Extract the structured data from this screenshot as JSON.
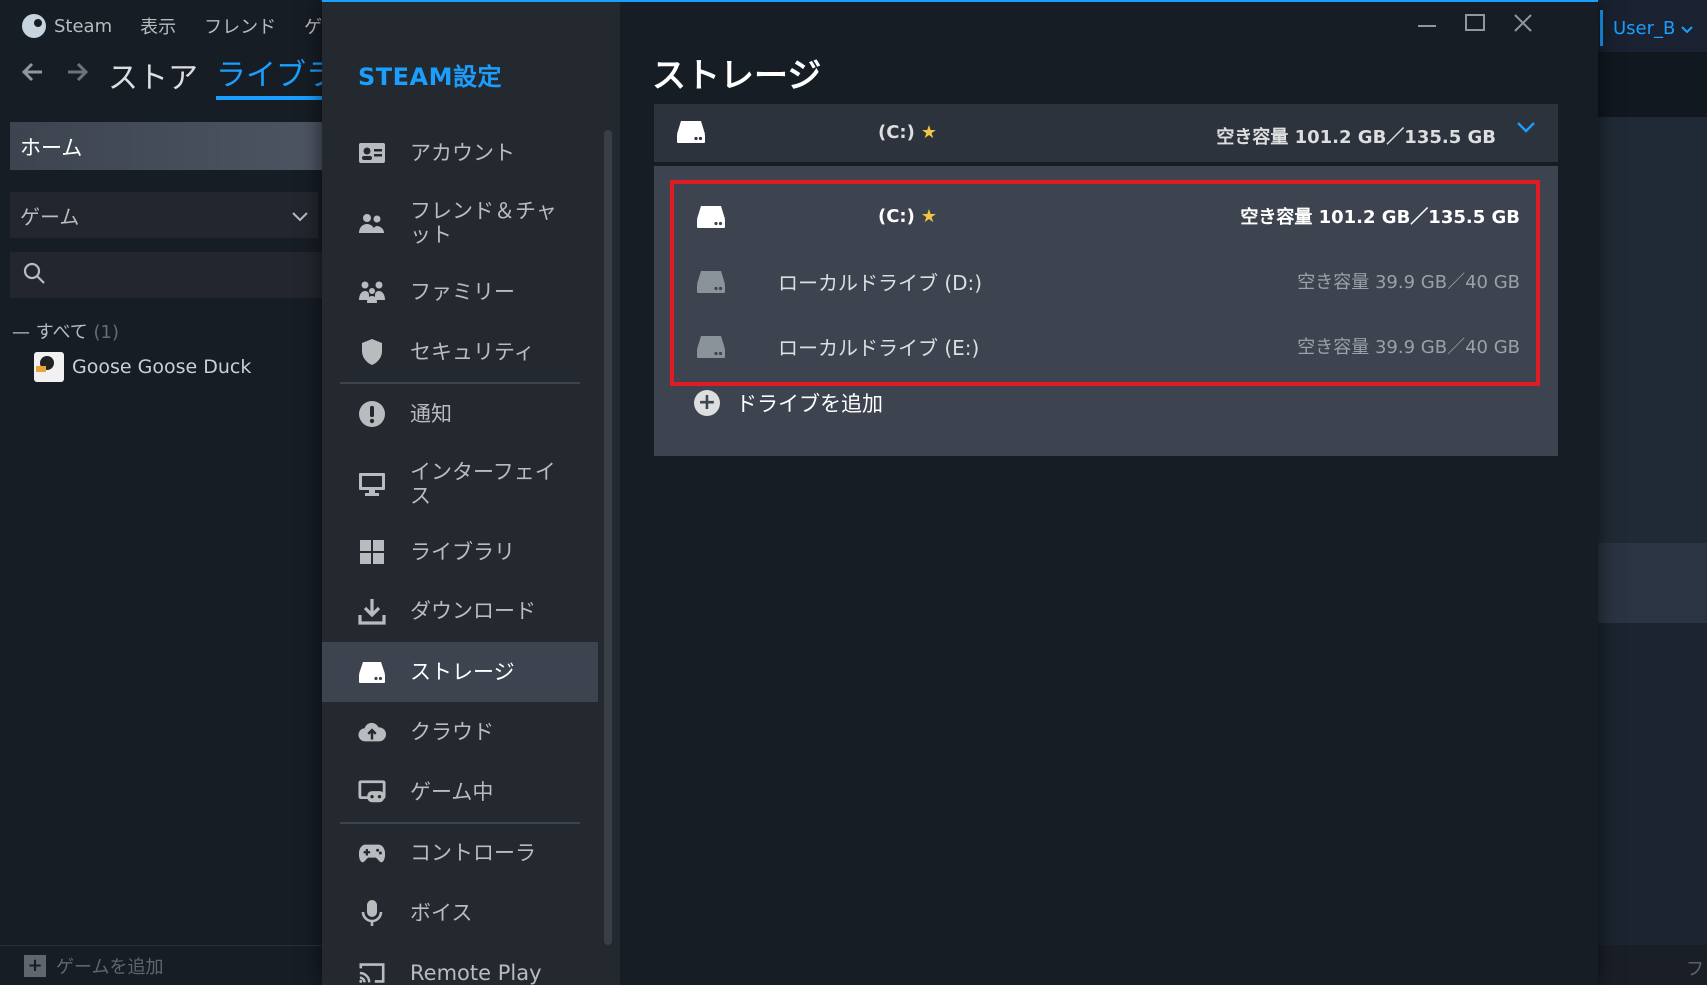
{
  "library": {
    "menu": {
      "steam": "Steam",
      "view": "表示",
      "friends": "フレンド",
      "games_partial": "ゲ"
    },
    "nav": {
      "back_icon": "arrow-left-icon",
      "forward_icon": "arrow-right-icon",
      "store": "ストア",
      "library": "ライブラ"
    },
    "home": "ホーム",
    "filter": "ゲーム",
    "all_label": "すべて",
    "all_count": "(1)",
    "game": "Goose Goose Duck",
    "add_game": "ゲームを追加",
    "right_bottom_partial": "フ",
    "user": "User_B"
  },
  "settings": {
    "title": "STEAM設定",
    "sidebar": [
      {
        "label": "アカウント",
        "icon": "account-card-icon"
      },
      {
        "label": "フレンド＆チャット",
        "icon": "friends-icon"
      },
      {
        "label": "ファミリー",
        "icon": "family-icon"
      },
      {
        "label": "セキュリティ",
        "icon": "shield-icon"
      },
      {
        "label": "通知",
        "icon": "notification-icon"
      },
      {
        "label": "インターフェイス",
        "icon": "monitor-icon"
      },
      {
        "label": "ライブラリ",
        "icon": "grid-icon"
      },
      {
        "label": "ダウンロード",
        "icon": "download-icon"
      },
      {
        "label": "ストレージ",
        "icon": "drive-icon"
      },
      {
        "label": "クラウド",
        "icon": "cloud-icon"
      },
      {
        "label": "ゲーム中",
        "icon": "in-game-icon"
      },
      {
        "label": "コントローラ",
        "icon": "gamepad-icon"
      },
      {
        "label": "ボイス",
        "icon": "microphone-icon"
      },
      {
        "label": "Remote Play",
        "icon": "cast-icon"
      }
    ],
    "active_item": "ストレージ",
    "page_title": "ストレージ",
    "selected_drive": {
      "name": "(C:)",
      "free": "空き容量 101.2 GB／135.5 GB"
    },
    "drives": [
      {
        "name": "(C:)",
        "free": "空き容量 101.2 GB／135.5 GB",
        "default": true
      },
      {
        "name": "ローカルドライブ (D:)",
        "free": "空き容量 39.9 GB／40 GB",
        "default": false
      },
      {
        "name": "ローカルドライブ (E:)",
        "free": "空き容量 39.9 GB／40 GB",
        "default": false
      }
    ],
    "add_drive": "ドライブを追加",
    "colors": {
      "accent": "#1a9fff",
      "highlight_border": "#e01b24",
      "star": "#f4c542"
    }
  }
}
